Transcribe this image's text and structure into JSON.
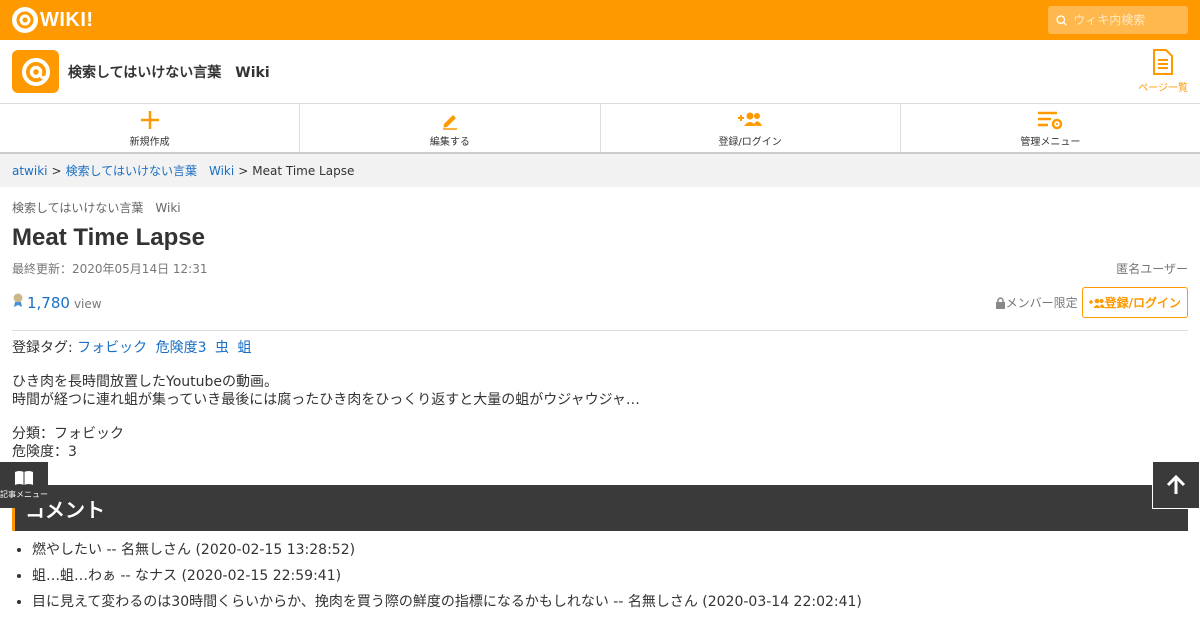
{
  "topbar": {
    "logo_text": "WIKI!",
    "search_placeholder": "ウィキ内検索",
    "accent_color": "#ff9900"
  },
  "site": {
    "name": "検索してはいけない言葉　Wiki",
    "page_list_label": "ページ一覧"
  },
  "actions": [
    {
      "label": "新規作成",
      "icon": "plus-icon"
    },
    {
      "label": "編集する",
      "icon": "pencil-icon"
    },
    {
      "label": "登録/ログイン",
      "icon": "add-user-icon"
    },
    {
      "label": "管理メニュー",
      "icon": "admin-settings-icon"
    }
  ],
  "breadcrumb": {
    "root": "atwiki",
    "sep": ">",
    "site": "検索してはいけない言葉　Wiki",
    "current": "Meat Time Lapse"
  },
  "article": {
    "site_small": "検索してはいけない言葉　Wiki",
    "title": "Meat Time Lapse",
    "updated": "最終更新：2020年05月14日 12:31",
    "author": "匿名ユーザー",
    "views": "1,780",
    "views_unit": "view",
    "member_only": "メンバー限定",
    "register_button": "登録/ログイン"
  },
  "content": {
    "tags_label": "登録タグ:",
    "tags": [
      "フォビック",
      "危険度3",
      "虫",
      "蛆"
    ],
    "desc_line1": "ひき肉を長時間放置したYoutubeの動画。",
    "desc_line2": "時間が経つに連れ蛆が集っていき最後には腐ったひき肉をひっくり返すと大量の蛆がウジャウジャ…",
    "category": "分類：フォビック",
    "danger": "危険度：3"
  },
  "comments": {
    "heading": "コメント",
    "items": [
      "燃やしたい -- 名無しさん (2020-02-15 13:28:52)",
      "蛆…蛆…わぁ -- なナス (2020-02-15 22:59:41)",
      "目に見えて変わるのは30時間くらいからか、挽肉を買う際の鮮度の指標になるかもしれない -- 名無しさん (2020-03-14 22:02:41)"
    ]
  },
  "side_menu_label": "記事メニュー"
}
